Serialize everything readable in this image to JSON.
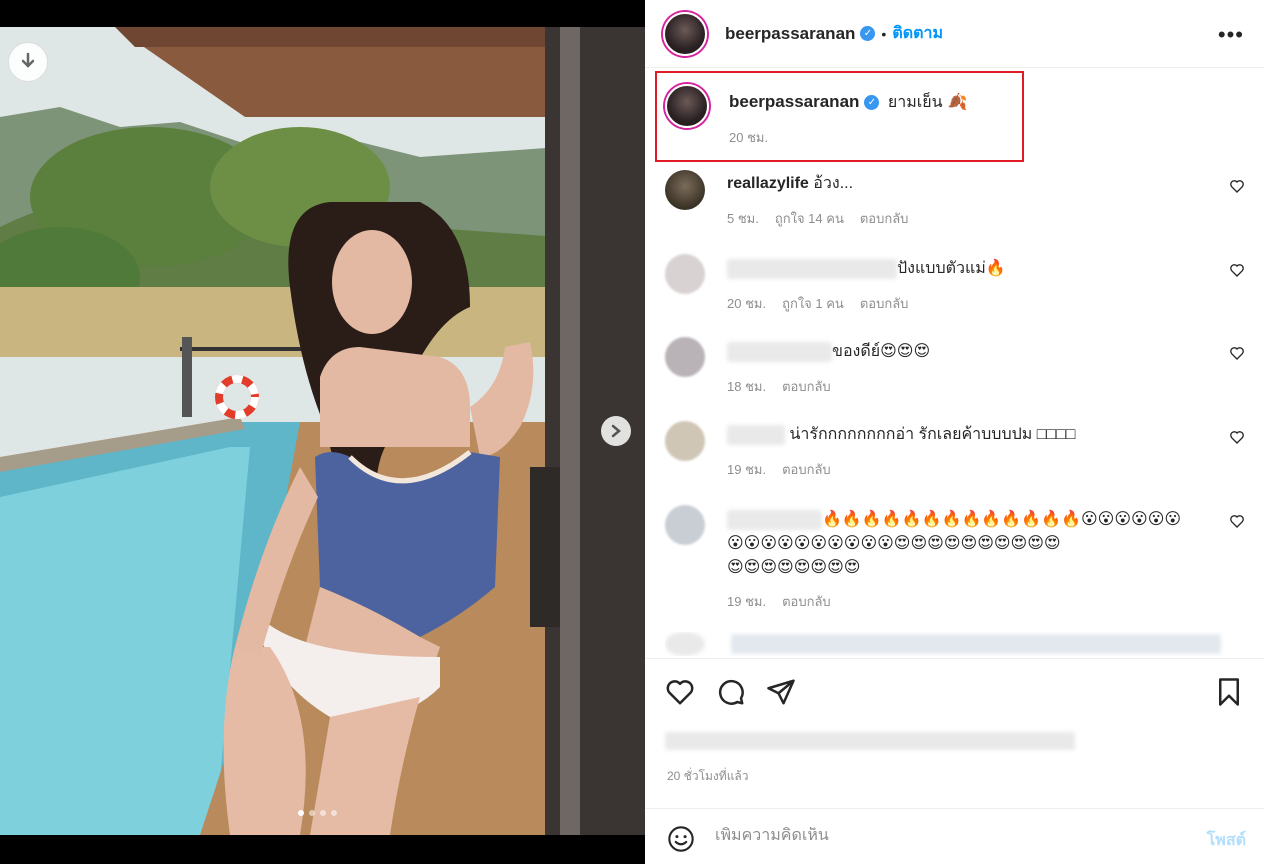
{
  "post": {
    "author": "beerpassaranan",
    "follow_label": "ติดตาม",
    "dot": "•",
    "more": "•••",
    "caption": "ยามเย็น 🍂",
    "caption_time": "20 ชม.",
    "timestamp": "20 ชั่วโมงที่แล้ว",
    "carousel_count": 4,
    "carousel_index": 1
  },
  "comments": [
    {
      "user": "reallazylife",
      "text": "อ้วง...",
      "time": "5 ชม.",
      "likes": "ถูกใจ 14 คน",
      "reply": "ตอบกลับ"
    },
    {
      "user": "",
      "text": "ปังแบบตัวแม่🔥",
      "time": "20 ชม.",
      "likes": "ถูกใจ 1 คน",
      "reply": "ตอบกลับ"
    },
    {
      "user": "",
      "text": "ของดีย์😍😍😍",
      "time": "18 ชม.",
      "likes": "",
      "reply": "ตอบกลับ"
    },
    {
      "user": "",
      "text": "น่ารักกกกกกกกอ่า รักเลยค้าบบบปม □□□□",
      "time": "19 ชม.",
      "likes": "",
      "reply": "ตอบกลับ"
    },
    {
      "user": "",
      "text_lines": [
        "🔥🔥🔥🔥🔥🔥🔥🔥🔥🔥🔥🔥🔥😮😮😮😮😮😮",
        "😮😮😮😮😮😮😮😮😮😮😍😍😍😍😍😍😍😍😍😍",
        "😍😍😍😍😍😍😍😍"
      ],
      "time": "19 ชม.",
      "likes": "",
      "reply": "ตอบกลับ"
    }
  ],
  "compose": {
    "placeholder": "เพิ่มความคิดเห็น",
    "post_label": "โพสต์"
  },
  "colors": {
    "accent": "#0095f6",
    "highlight_border": "#e01b24",
    "verified": "#3897f0"
  }
}
